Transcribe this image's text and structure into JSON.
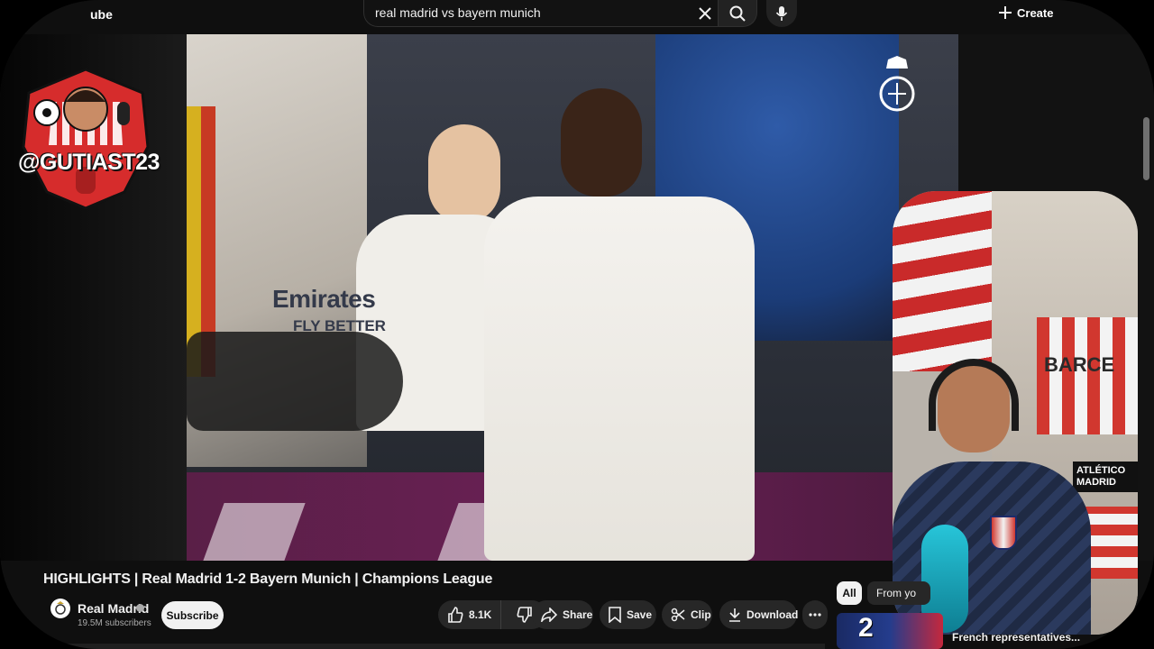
{
  "topbar": {
    "brand_fragment": "ube",
    "search_value": "real madrid vs bayern munich",
    "create_label": "Create",
    "icons": [
      "clear-icon",
      "search-icon",
      "mic-icon",
      "plus-icon"
    ]
  },
  "overlay": {
    "handle": "@GUTIAST23"
  },
  "video": {
    "sponsor_line1": "Emirates",
    "sponsor_line2": "FLY BETTER"
  },
  "webcam": {
    "wall_text1": "BARCE",
    "wall_text2": "ATLÉTICO MADRID"
  },
  "watch": {
    "title": "HIGHLIGHTS | Real Madrid 1-2 Bayern Munich | Champions League",
    "channel_name": "Real Madrid",
    "subscribers": "19.5M subscribers",
    "subscribe_label": "Subscribe",
    "like_count": "8.1K",
    "share_label": "Share",
    "save_label": "Save",
    "clip_label": "Clip",
    "download_label": "Download"
  },
  "recommendations": {
    "chips": [
      "All",
      "From yo"
    ],
    "first_thumb_number": "2",
    "first_title": "French representatives..."
  },
  "colors": {
    "background": "#0f0f0f",
    "pill": "#272727",
    "subscribe_bg": "#f1f1f1",
    "overlay_red": "#d62c2c"
  }
}
